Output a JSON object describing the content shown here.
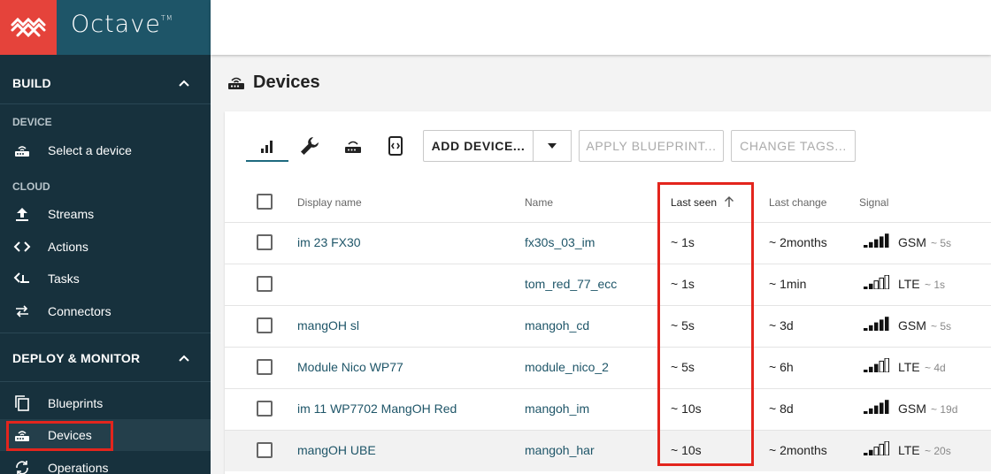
{
  "brand": {
    "name": "Octave",
    "tm": "TM"
  },
  "sidebar": {
    "build": {
      "title": "BUILD",
      "sub_device": "DEVICE",
      "sub_cloud": "CLOUD"
    },
    "items": [
      {
        "label": "Select a device",
        "icon": "router-icon"
      },
      {
        "label": "Streams",
        "icon": "upload-icon"
      },
      {
        "label": "Actions",
        "icon": "code-icon"
      },
      {
        "label": "Tasks",
        "icon": "task-icon"
      },
      {
        "label": "Connectors",
        "icon": "swap-arrows-icon"
      }
    ],
    "deploy": {
      "title": "DEPLOY & MONITOR"
    },
    "deploy_items": [
      {
        "label": "Blueprints",
        "icon": "copy-icon"
      },
      {
        "label": "Devices",
        "icon": "router-icon",
        "active": true
      },
      {
        "label": "Operations",
        "icon": "sync-icon"
      }
    ]
  },
  "page": {
    "title": "Devices"
  },
  "toolbar": {
    "add_device": "ADD DEVICE...",
    "apply_blueprint": "APPLY BLUEPRINT...",
    "change_tags": "CHANGE TAGS..."
  },
  "table": {
    "headers": {
      "display_name": "Display name",
      "name": "Name",
      "last_seen": "Last seen",
      "last_change": "Last change",
      "signal": "Signal"
    },
    "rows": [
      {
        "display_name": "im 23 FX30",
        "name": "fx30s_03_im",
        "last_seen": "~ 1s",
        "last_change": "~ 2months",
        "signal_level": 5,
        "signal_type": "GSM",
        "signal_time": "~ 5s"
      },
      {
        "display_name": "",
        "name": "tom_red_77_ecc",
        "last_seen": "~ 1s",
        "last_change": "~ 1min",
        "signal_level": 2,
        "signal_type": "LTE",
        "signal_time": "~ 1s"
      },
      {
        "display_name": "mangOH sl",
        "name": "mangoh_cd",
        "last_seen": "~ 5s",
        "last_change": "~ 3d",
        "signal_level": 5,
        "signal_type": "GSM",
        "signal_time": "~ 5s"
      },
      {
        "display_name": "Module Nico WP77",
        "name": "module_nico_2",
        "last_seen": "~ 5s",
        "last_change": "~ 6h",
        "signal_level": 3,
        "signal_type": "LTE",
        "signal_time": "~ 4d"
      },
      {
        "display_name": "im 11 WP7702 MangOH Red",
        "name": "mangoh_im",
        "last_seen": "~ 10s",
        "last_change": "~ 8d",
        "signal_level": 5,
        "signal_type": "GSM",
        "signal_time": "~ 19d"
      },
      {
        "display_name": "mangOH UBE",
        "name": "mangoh_har",
        "last_seen": "~ 10s",
        "last_change": "~ 2months",
        "signal_level": 2,
        "signal_type": "LTE",
        "signal_time": "~ 20s"
      }
    ]
  },
  "colors": {
    "accent": "#1e5568",
    "sidebar": "#17313d",
    "highlight": "#e3251d",
    "logo_bg": "#e5433b"
  }
}
